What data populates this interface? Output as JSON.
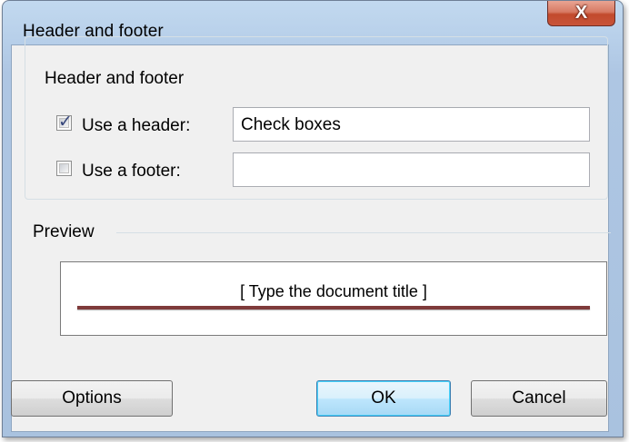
{
  "window": {
    "title": "Header and footer",
    "close_glyph": "X",
    "close_icon": "close-icon"
  },
  "group": {
    "legend": "Header and footer",
    "header": {
      "label": "Use a header:",
      "checked": true,
      "value": "Check boxes"
    },
    "footer": {
      "label": "Use a footer:",
      "checked": false,
      "value": ""
    }
  },
  "preview": {
    "label": "Preview",
    "document_title": "[ Type the document title ]",
    "rule_color": "#7f3b3b"
  },
  "buttons": {
    "options": "Options",
    "ok": "OK",
    "cancel": "Cancel"
  }
}
